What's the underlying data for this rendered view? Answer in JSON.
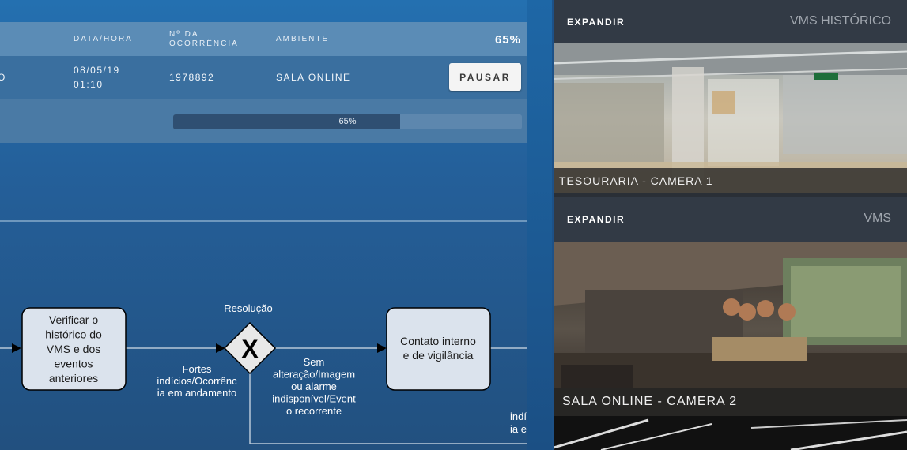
{
  "table": {
    "headers": {
      "datetime": "DATA/HORA",
      "occurrence_line1": "Nº DA",
      "occurrence_line2": "OCORRÊNCIA",
      "environment": "AMBIENTE",
      "percent": "65%"
    },
    "row": {
      "cut_text": "O",
      "date": "08/05/19",
      "time": "01:10",
      "occurrence": "1978892",
      "environment": "SALA ONLINE",
      "pause_label": "PAUSAR"
    }
  },
  "progress": {
    "value": 0.65,
    "label": "65%"
  },
  "flow": {
    "task1_lines": [
      "Verificar o",
      "histórico do",
      "VMS e dos",
      "eventos",
      "anteriores"
    ],
    "gateway_label": "Resolução",
    "gateway_symbol": "X",
    "branch_left_lines": [
      "Fortes",
      "indícios/Ocorrênc",
      "ia em andamento"
    ],
    "branch_right_lines": [
      "Sem",
      "alteração/Imagem",
      "ou alarme",
      "indisponível/Event",
      "o recorrente"
    ],
    "task2_lines": [
      "Contato interno",
      "e de vigilância"
    ],
    "edge_text_lines": [
      "indí",
      "ia e"
    ]
  },
  "vms_panels": [
    {
      "expand_label": "EXPANDIR",
      "title": "VMS HISTÓRICO",
      "camera_caption": "TESOURARIA - CAMERA 1"
    },
    {
      "expand_label": "EXPANDIR",
      "title": "VMS",
      "camera_caption": "SALA ONLINE - CAMERA 2"
    }
  ],
  "colors": {
    "header_bg": "#5b8cb6",
    "row_bg": "#3a6f9f",
    "progress_fill": "#2f4f72",
    "task_fill": "#dbe3ed",
    "panel_header_bg": "#323a45"
  }
}
